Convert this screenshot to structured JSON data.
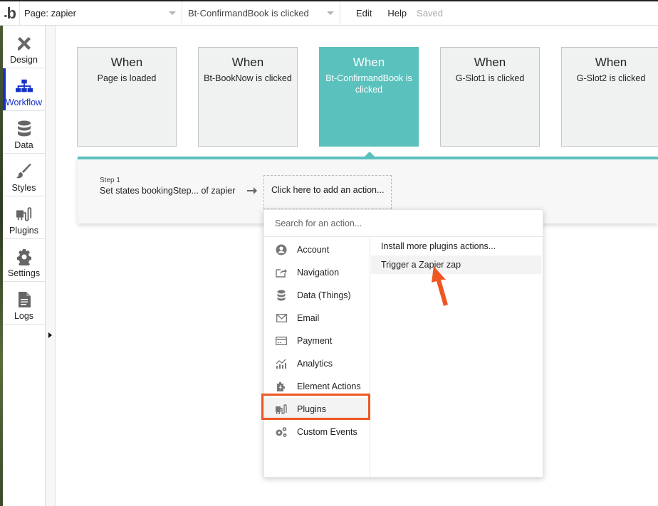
{
  "topbar": {
    "logo": "b",
    "page_dropdown": "Page: zapier",
    "event_dropdown": "Bt-ConfirmandBook is clicked",
    "menu": [
      "Edit",
      "Help"
    ],
    "status": "Saved"
  },
  "leftnav": {
    "items": [
      {
        "label": "Design",
        "icon": "design-icon"
      },
      {
        "label": "Workflow",
        "icon": "workflow-icon",
        "active": true
      },
      {
        "label": "Data",
        "icon": "database-icon"
      },
      {
        "label": "Styles",
        "icon": "brush-icon"
      },
      {
        "label": "Plugins",
        "icon": "plug-icon"
      },
      {
        "label": "Settings",
        "icon": "gear-icon"
      },
      {
        "label": "Logs",
        "icon": "document-icon"
      }
    ]
  },
  "events": [
    {
      "when": "When",
      "what": "Page is loaded"
    },
    {
      "when": "When",
      "what": "Bt-BookNow is clicked"
    },
    {
      "when": "When",
      "what": "Bt-ConfirmandBook is clicked",
      "selected": true
    },
    {
      "when": "When",
      "what": "G-Slot1 is clicked"
    },
    {
      "when": "When",
      "what": "G-Slot2 is clicked"
    }
  ],
  "workflow": {
    "step_label": "Step 1",
    "step_text": "Set states bookingStep... of zapier",
    "add_action": "Click here to add an action..."
  },
  "action_menu": {
    "search_placeholder": "Search for an action...",
    "categories": [
      {
        "label": "Account",
        "icon": "account-icon"
      },
      {
        "label": "Navigation",
        "icon": "navigation-icon"
      },
      {
        "label": "Data (Things)",
        "icon": "database-icon"
      },
      {
        "label": "Email",
        "icon": "email-icon"
      },
      {
        "label": "Payment",
        "icon": "payment-icon"
      },
      {
        "label": "Analytics",
        "icon": "analytics-icon"
      },
      {
        "label": "Element Actions",
        "icon": "element-actions-icon"
      },
      {
        "label": "Plugins",
        "icon": "plug-icon",
        "selected": true
      },
      {
        "label": "Custom Events",
        "icon": "custom-events-icon"
      }
    ],
    "sub_actions": [
      {
        "label": "Install more plugins actions..."
      },
      {
        "label": "Trigger a Zapier zap",
        "hover": true
      }
    ]
  },
  "colors": {
    "accent_teal": "#5bc1bd",
    "active_blue": "#1432c8",
    "annotation_orange": "#ee5722"
  }
}
